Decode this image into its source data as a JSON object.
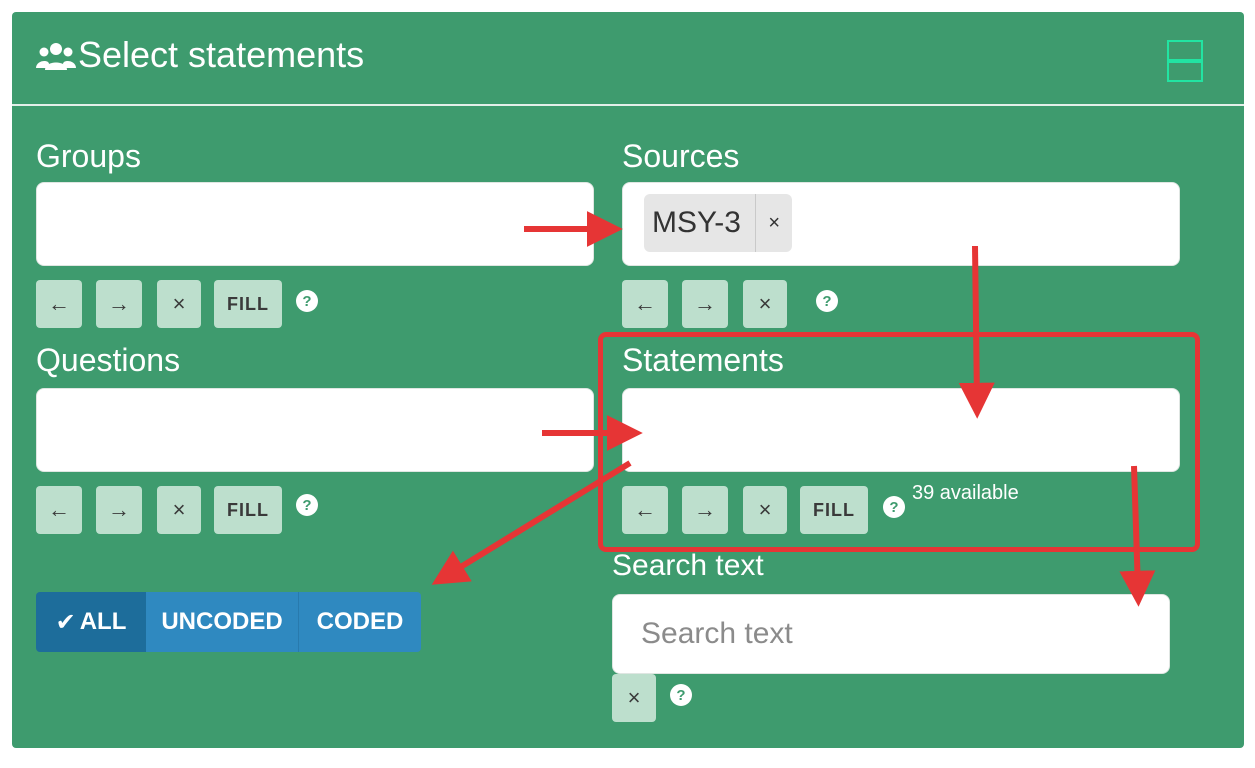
{
  "panel": {
    "title": "Select statements",
    "icon": "users-icon",
    "collapse_icon": "collapse-icon"
  },
  "groups": {
    "label": "Groups",
    "value": "",
    "buttons": {
      "prev": "←",
      "next": "→",
      "clear": "×",
      "fill": "FILL"
    }
  },
  "sources": {
    "label": "Sources",
    "selected_tags": [
      {
        "label": "MSY-3",
        "remove": "×"
      }
    ],
    "buttons": {
      "prev": "←",
      "next": "→",
      "clear": "×"
    }
  },
  "questions": {
    "label": "Questions",
    "value": "",
    "buttons": {
      "prev": "←",
      "next": "→",
      "clear": "×",
      "fill": "FILL"
    }
  },
  "statements": {
    "label": "Statements",
    "value": "",
    "buttons": {
      "prev": "←",
      "next": "→",
      "clear": "×",
      "fill": "FILL"
    },
    "available_text": "39 available"
  },
  "filter": {
    "options": [
      "ALL",
      "UNCODED",
      "CODED"
    ],
    "selected": "ALL",
    "checkmark": "✔"
  },
  "search": {
    "label": "Search text",
    "placeholder": "Search text",
    "clear": "×"
  },
  "colors": {
    "panel_bg": "#3e9b6e",
    "button_bg": "#bddfcd",
    "annotation_red": "#e63535",
    "segment_active": "#1d6d9b",
    "segment_default": "#2f89c0",
    "collapse_accent": "#22e4a2"
  }
}
